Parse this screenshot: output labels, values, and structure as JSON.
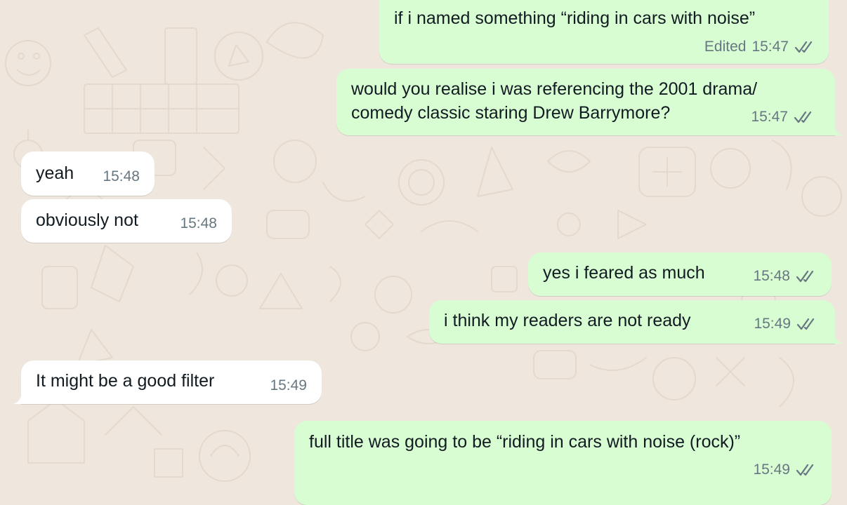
{
  "conversation": {
    "messages": [
      {
        "direction": "outgoing",
        "text": "if i named something “riding in cars with noise”",
        "edited_label": "Edited",
        "time": "15:47",
        "status": "read"
      },
      {
        "direction": "outgoing",
        "lines": [
          "would you realise i was referencing the 2001 drama/",
          "comedy classic staring Drew Barrymore?"
        ],
        "time": "15:47",
        "status": "read"
      },
      {
        "direction": "incoming",
        "text": "yeah",
        "time": "15:48"
      },
      {
        "direction": "incoming",
        "text": "obviously not",
        "time": "15:48"
      },
      {
        "direction": "outgoing",
        "text": "yes i feared as much",
        "time": "15:48",
        "status": "read"
      },
      {
        "direction": "outgoing",
        "text": "i think my readers are not ready",
        "time": "15:49",
        "status": "read"
      },
      {
        "direction": "incoming",
        "text": "It might be a good filter",
        "time": "15:49"
      },
      {
        "direction": "outgoing",
        "text": "full title was going to be “riding in cars with noise (rock)”",
        "time": "15:49",
        "status": "read"
      }
    ]
  },
  "colors": {
    "wallpaper": "#efe7dd",
    "outgoing_bubble": "#d9fdd3",
    "incoming_bubble": "#ffffff",
    "meta_text": "#667781",
    "read_ticks": "#667781"
  },
  "icons": {
    "read_receipt": "double-check-icon"
  }
}
